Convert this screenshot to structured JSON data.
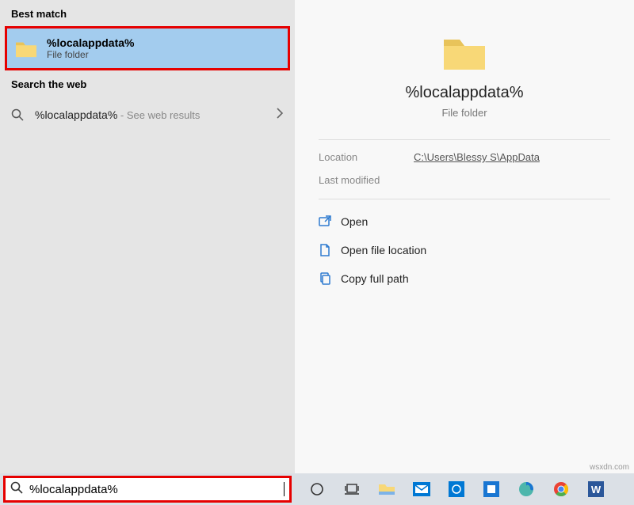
{
  "headers": {
    "best_match": "Best match",
    "search_web": "Search the web"
  },
  "best_match": {
    "title": "%localappdata%",
    "subtitle": "File folder"
  },
  "web_result": {
    "query": "%localappdata%",
    "suffix": " - See web results"
  },
  "preview": {
    "title": "%localappdata%",
    "subtitle": "File folder",
    "location_label": "Location",
    "location_value": "C:\\Users\\Blessy S\\AppData",
    "modified_label": "Last modified",
    "actions": {
      "open": "Open",
      "open_location": "Open file location",
      "copy_path": "Copy full path"
    }
  },
  "search": {
    "value": "%localappdata%"
  },
  "watermark": "wsxdn.com"
}
